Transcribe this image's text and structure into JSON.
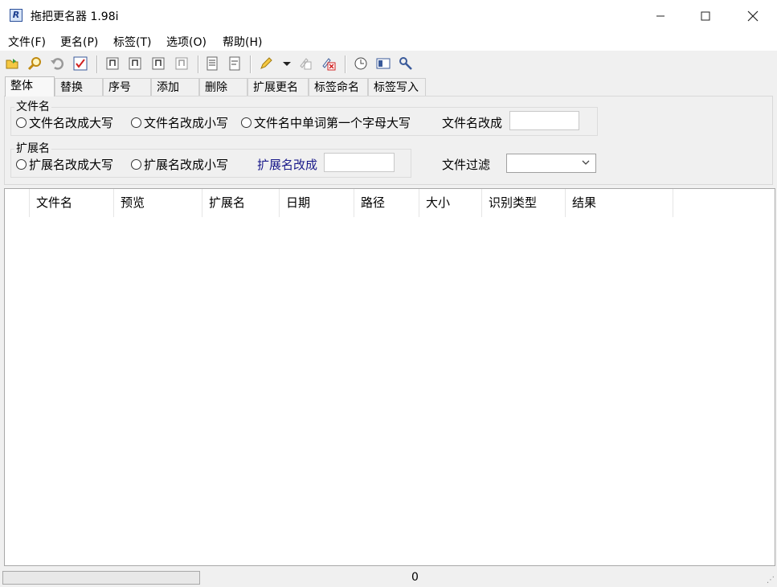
{
  "window": {
    "title": "拖把更名器 1.98i",
    "icon_letter": "R"
  },
  "menu": [
    "文件(F)",
    "更名(P)",
    "标签(T)",
    "选项(O)",
    "帮助(H)"
  ],
  "toolbar_icons": [
    "open-folder-icon",
    "search-icon",
    "undo-icon",
    "check-icon",
    "music-tag-1-icon",
    "music-tag-2-icon",
    "music-tag-3-icon",
    "music-tag-4-icon",
    "document-icon",
    "document-edit-icon",
    "pencil-icon",
    "dropdown-arrow-icon",
    "clear-icon",
    "delete-icon",
    "clock-icon",
    "panel-icon",
    "tool-icon"
  ],
  "tabs": [
    "整体",
    "替换",
    "序号",
    "添加",
    "删除",
    "扩展更名",
    "标签命名",
    "标签写入"
  ],
  "filename_group": {
    "label": "文件名",
    "options": [
      "文件名改成大写",
      "文件名改成小写",
      "文件名中单词第一个字母大写"
    ],
    "change_label": "文件名改成",
    "change_value": ""
  },
  "ext_group": {
    "label": "扩展名",
    "options": [
      "扩展名改成大写",
      "扩展名改成小写"
    ],
    "change_label": "扩展名改成",
    "change_value": ""
  },
  "filter": {
    "label": "文件过滤",
    "value": ""
  },
  "columns": [
    "文件名",
    "预览",
    "扩展名",
    "日期",
    "路径",
    "大小",
    "识别类型",
    "结果"
  ],
  "status": {
    "count": "0"
  },
  "colors": {
    "link_blue": "#1a1a8a"
  }
}
